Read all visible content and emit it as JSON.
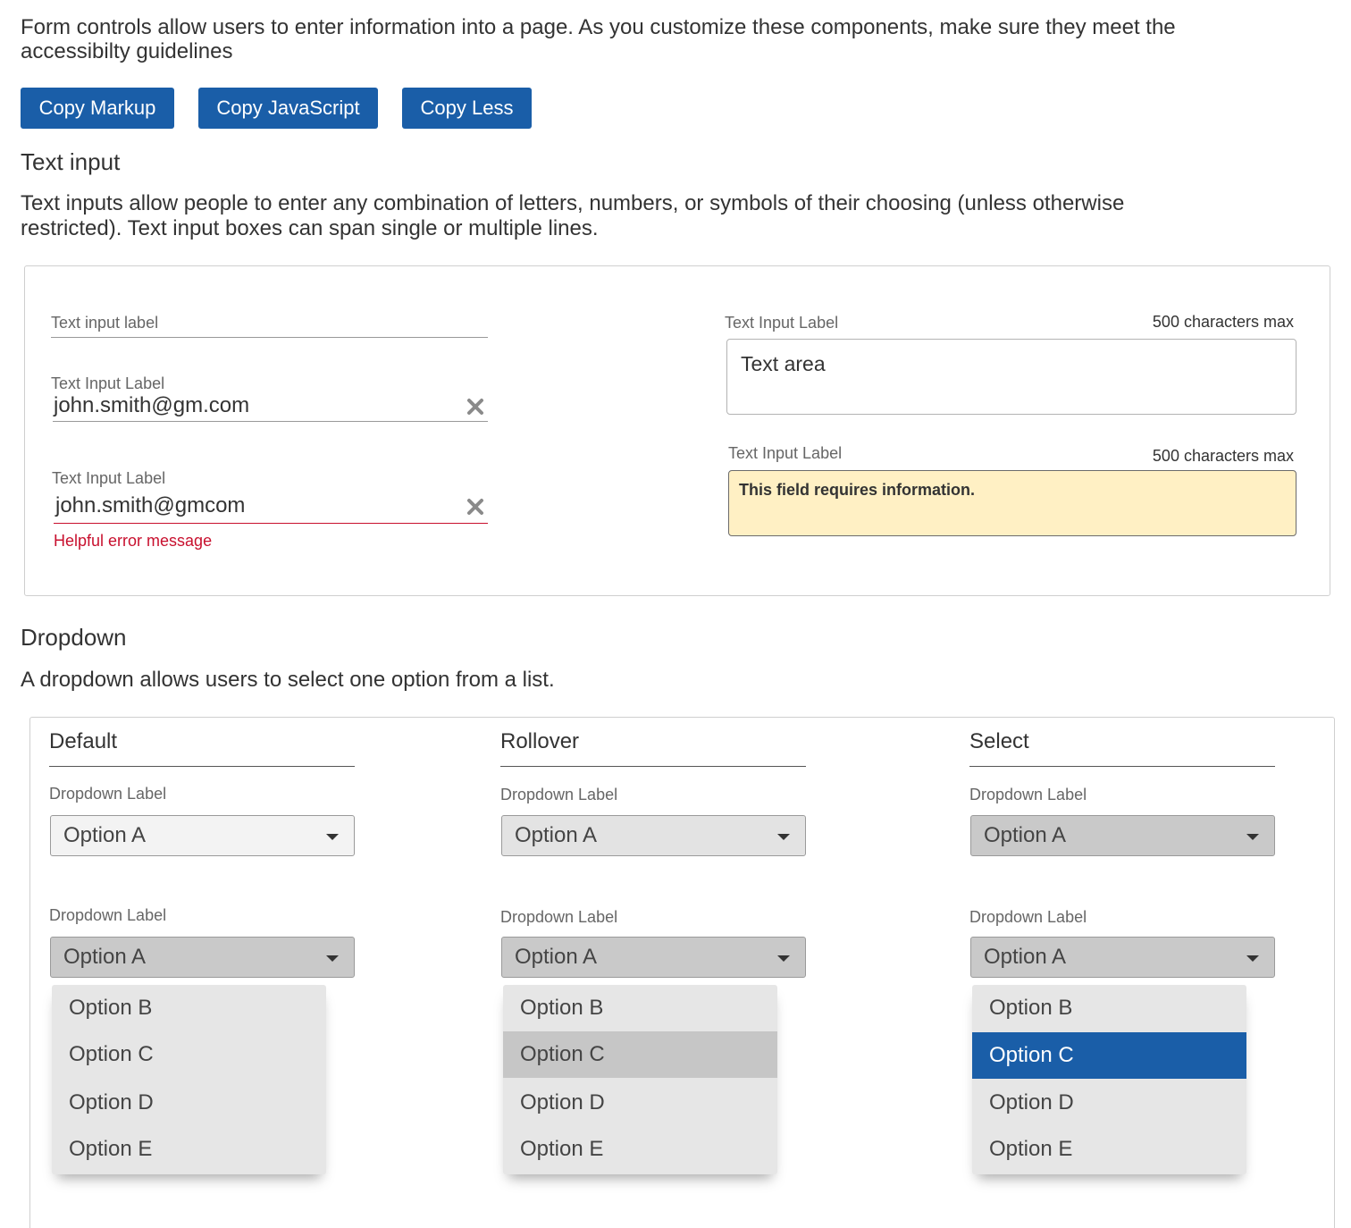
{
  "intro": "Form controls allow users to enter information into a page. As you customize these components, make sure they meet the accessibilty guidelines",
  "buttons": {
    "copy_markup": "Copy Markup",
    "copy_js": "Copy JavaScript",
    "copy_less": "Copy Less"
  },
  "text_input": {
    "heading": "Text input",
    "description": "Text inputs allow people to enter any combination of letters, numbers, or symbols of their choosing (unless otherwise restricted). Text input boxes can span single or multiple lines.",
    "empty_field": {
      "placeholder": "Text input label"
    },
    "filled_field": {
      "label": "Text Input Label",
      "value": "john.smith@gm.com"
    },
    "error_field": {
      "label": "Text Input Label",
      "value": "john.smith@gmcom",
      "error": "Helpful error message"
    },
    "textarea": {
      "label": "Text Input Label",
      "counter": "500 characters max",
      "value": "Text area"
    },
    "textarea_error": {
      "label": "Text Input Label",
      "counter": "500 characters max",
      "message": "This field requires information."
    }
  },
  "dropdown": {
    "heading": "Dropdown",
    "description": "A dropdown allows users to select one option from a list.",
    "columns": [
      {
        "title": "Default",
        "label1": "Dropdown Label",
        "value1": "Option A",
        "label2": "Dropdown Label",
        "value2": "Option A",
        "options": [
          "Option B",
          "Option C",
          "Option D",
          "Option E"
        ]
      },
      {
        "title": "Rollover",
        "label1": "Dropdown Label",
        "value1": "Option A",
        "label2": "Dropdown Label",
        "value2": "Option A",
        "options": [
          "Option B",
          "Option C",
          "Option D",
          "Option E"
        ]
      },
      {
        "title": "Select",
        "label1": "Dropdown Label",
        "value1": "Option A",
        "label2": "Dropdown Label",
        "value2": "Option A",
        "options": [
          "Option B",
          "Option C",
          "Option D",
          "Option E"
        ]
      }
    ]
  },
  "colors": {
    "primary": "#1a5ea8",
    "error": "#c8102e",
    "warning_bg": "#fff0c4",
    "hover": "#c9c9c9"
  }
}
